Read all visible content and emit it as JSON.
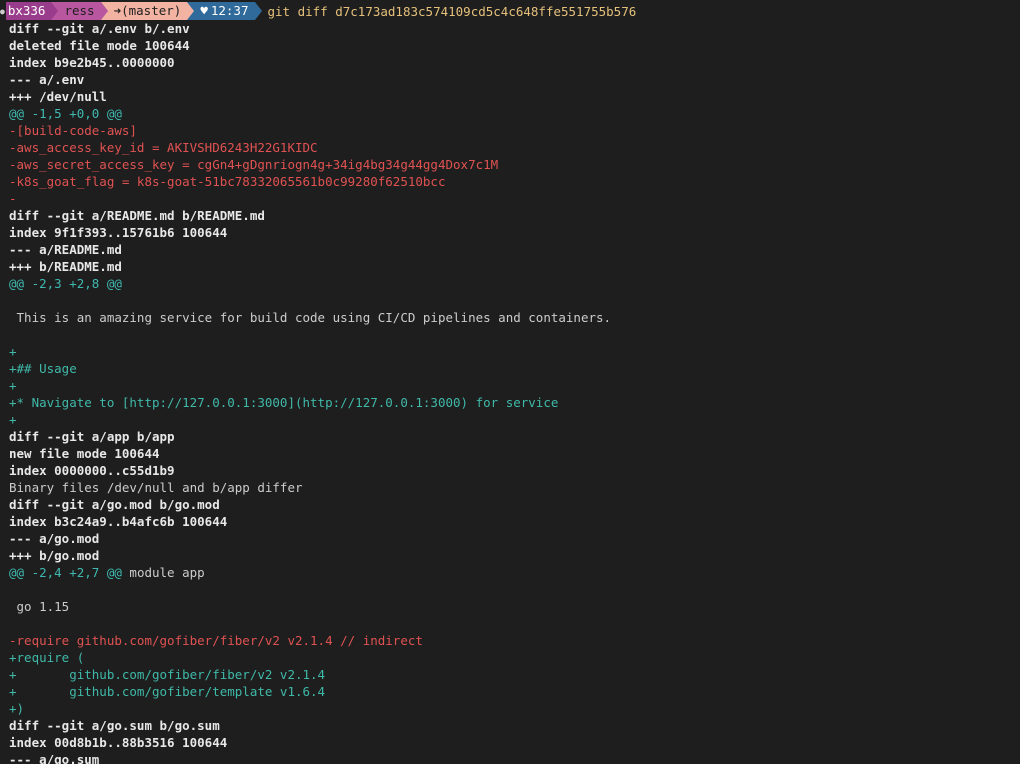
{
  "prompt": {
    "user": "bx336",
    "dir": "ress",
    "git": "(master)",
    "time": "12:37",
    "command": "git diff d7c173ad183c574109cd5c4c648ffe551755b576",
    "colors": {
      "user_bg": "#9a3c8c",
      "dir_bg": "#b8579f",
      "git_bg": "#f2b3a2",
      "time_bg": "#2f6a9a",
      "command": "#e5c07b"
    }
  },
  "lines": [
    {
      "type": "meta",
      "text": "diff --git a/.env b/.env"
    },
    {
      "type": "meta",
      "text": "deleted file mode 100644"
    },
    {
      "type": "meta",
      "text": "index b9e2b45..0000000"
    },
    {
      "type": "meta",
      "text": "--- a/.env"
    },
    {
      "type": "meta",
      "text": "+++ /dev/null"
    },
    {
      "type": "hunk",
      "text": "@@ -1,5 +0,0 @@"
    },
    {
      "type": "del",
      "text": "-[build-code-aws]"
    },
    {
      "type": "del",
      "text": "-aws_access_key_id = AKIVSHD6243H22G1KIDC"
    },
    {
      "type": "del",
      "text": "-aws_secret_access_key = cgGn4+gDgnriogn4g+34ig4bg34g44gg4Dox7c1M"
    },
    {
      "type": "del",
      "text": "-k8s_goat_flag = k8s-goat-51bc78332065561b0c99280f62510bcc"
    },
    {
      "type": "del",
      "text": "-"
    },
    {
      "type": "meta",
      "text": "diff --git a/README.md b/README.md"
    },
    {
      "type": "meta",
      "text": "index 9f1f393..15761b6 100644"
    },
    {
      "type": "meta",
      "text": "--- a/README.md"
    },
    {
      "type": "meta",
      "text": "+++ b/README.md"
    },
    {
      "type": "hunk",
      "text": "@@ -2,3 +2,8 @@"
    },
    {
      "type": "ctx",
      "text": ""
    },
    {
      "type": "ctx",
      "text": " This is an amazing service for build code using CI/CD pipelines and containers."
    },
    {
      "type": "ctx",
      "text": ""
    },
    {
      "type": "add",
      "text": "+"
    },
    {
      "type": "add",
      "text": "+## Usage"
    },
    {
      "type": "add",
      "text": "+"
    },
    {
      "type": "add",
      "text": "+* Navigate to [http://127.0.0.1:3000](http://127.0.0.1:3000) for service"
    },
    {
      "type": "add",
      "text": "+"
    },
    {
      "type": "meta",
      "text": "diff --git a/app b/app"
    },
    {
      "type": "meta",
      "text": "new file mode 100644"
    },
    {
      "type": "meta",
      "text": "index 0000000..c55d1b9"
    },
    {
      "type": "ctx",
      "text": "Binary files /dev/null and b/app differ"
    },
    {
      "type": "meta",
      "text": "diff --git a/go.mod b/go.mod"
    },
    {
      "type": "meta",
      "text": "index b3c24a9..b4afc6b 100644"
    },
    {
      "type": "meta",
      "text": "--- a/go.mod"
    },
    {
      "type": "meta",
      "text": "+++ b/go.mod"
    },
    {
      "type": "hunk",
      "text": "@@ -2,4 +2,7 @@",
      "suffix": " module app"
    },
    {
      "type": "ctx",
      "text": ""
    },
    {
      "type": "ctx",
      "text": " go 1.15"
    },
    {
      "type": "ctx",
      "text": ""
    },
    {
      "type": "del",
      "text": "-require github.com/gofiber/fiber/v2 v2.1.4 // indirect"
    },
    {
      "type": "add",
      "text": "+require ("
    },
    {
      "type": "add",
      "text": "+       github.com/gofiber/fiber/v2 v2.1.4"
    },
    {
      "type": "add",
      "text": "+       github.com/gofiber/template v1.6.4"
    },
    {
      "type": "add",
      "text": "+)"
    },
    {
      "type": "meta",
      "text": "diff --git a/go.sum b/go.sum"
    },
    {
      "type": "meta",
      "text": "index 00d8b1b..88b3516 100644"
    },
    {
      "type": "meta",
      "text": "--- a/go.sum"
    }
  ],
  "colors": {
    "background": "#1e1e1e",
    "meta": "#e8e8e8",
    "hunk": "#3fb9b0",
    "deleted": "#e05252",
    "added": "#3fb9a8"
  }
}
